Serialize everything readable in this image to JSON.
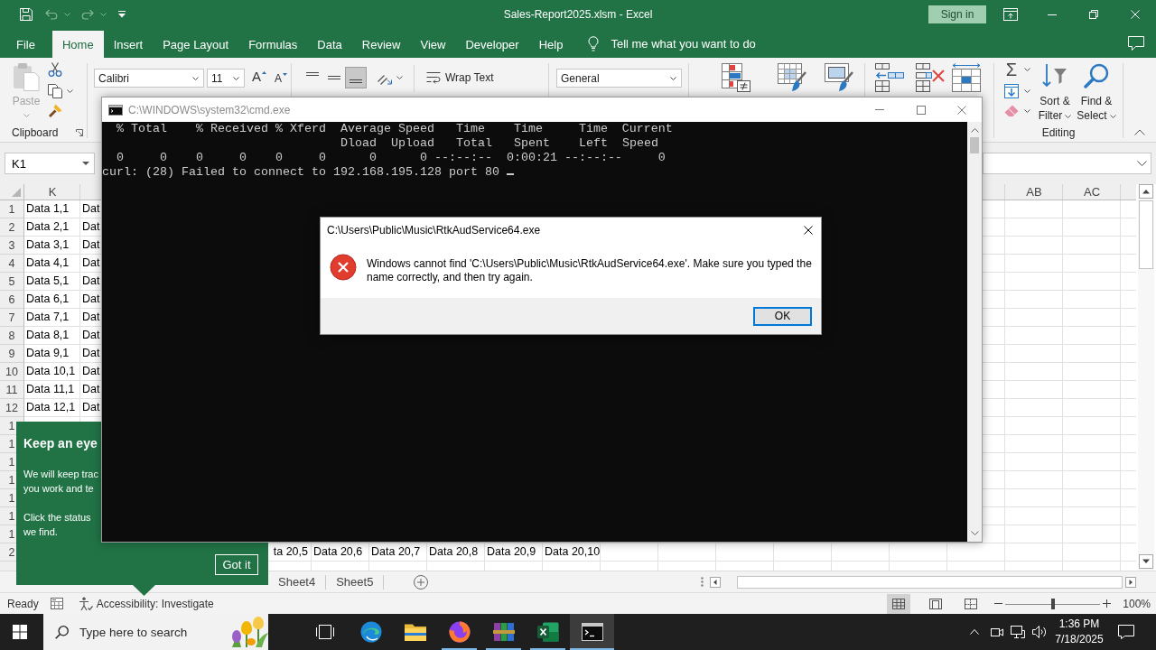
{
  "excel": {
    "quick_access": [
      {
        "kind": "save",
        "disabled": false
      },
      {
        "kind": "undo",
        "disabled": true
      },
      {
        "kind": "redo",
        "disabled": true
      },
      {
        "kind": "customize",
        "disabled": false
      }
    ],
    "title": "Sales-Report2025.xlsm - Excel",
    "sign_in": "Sign in",
    "tabs": [
      {
        "label": "File",
        "selected": false
      },
      {
        "label": "Home",
        "selected": true
      },
      {
        "label": "Insert",
        "selected": false
      },
      {
        "label": "Page Layout",
        "selected": false
      },
      {
        "label": "Formulas",
        "selected": false
      },
      {
        "label": "Data",
        "selected": false
      },
      {
        "label": "Review",
        "selected": false
      },
      {
        "label": "View",
        "selected": false
      },
      {
        "label": "Developer",
        "selected": false
      },
      {
        "label": "Help",
        "selected": false
      }
    ],
    "tell_me": "Tell me what you want to do",
    "ribbon": {
      "clipboard": {
        "paste": {
          "label": "Paste",
          "disabled": true
        },
        "label": "Clipboard"
      },
      "font": {
        "name": "Calibri",
        "size": "11",
        "grow": "A",
        "shrink": "A"
      },
      "alignment": {
        "vertical": [
          {
            "kind": "top",
            "selected": false
          },
          {
            "kind": "middle",
            "selected": false
          },
          {
            "kind": "bottom",
            "selected": true
          }
        ],
        "wrap_text": "Wrap Text"
      },
      "number": {
        "format": "General"
      },
      "editing": {
        "autosum": "Σ",
        "sort_filter": "Sort & Filter",
        "find_select": "Find & Select",
        "label": "Editing"
      }
    },
    "name_box": "K1",
    "sheet": {
      "left_column_headers": [
        "K"
      ],
      "right_column_headers": [
        "AB",
        "AC"
      ],
      "rows": [
        {
          "kind": "left",
          "header": "1",
          "cells": [
            "Data 1,1",
            "Dat"
          ]
        },
        {
          "kind": "left",
          "header": "2",
          "cells": [
            "Data 2,1",
            "Dat"
          ]
        },
        {
          "kind": "left",
          "header": "3",
          "cells": [
            "Data 3,1",
            "Dat"
          ]
        },
        {
          "kind": "left",
          "header": "4",
          "cells": [
            "Data 4,1",
            "Dat"
          ]
        },
        {
          "kind": "left",
          "header": "5",
          "cells": [
            "Data 5,1",
            "Dat"
          ]
        },
        {
          "kind": "left",
          "header": "6",
          "cells": [
            "Data 6,1",
            "Dat"
          ]
        },
        {
          "kind": "left",
          "header": "7",
          "cells": [
            "Data 7,1",
            "Dat"
          ]
        },
        {
          "kind": "left",
          "header": "8",
          "cells": [
            "Data 8,1",
            "Dat"
          ]
        },
        {
          "kind": "left",
          "header": "9",
          "cells": [
            "Data 9,1",
            "Dat"
          ]
        },
        {
          "kind": "left",
          "header": "10",
          "cells": [
            "Data 10,1",
            "Dat"
          ]
        },
        {
          "kind": "left",
          "header": "11",
          "cells": [
            "Data 11,1",
            "Dat"
          ]
        },
        {
          "kind": "left",
          "header": "12",
          "cells": [
            "Data 12,1",
            "Dat"
          ]
        },
        {
          "kind": "left",
          "header": "1"
        },
        {
          "kind": "left",
          "header": "1"
        },
        {
          "kind": "left",
          "header": "1"
        },
        {
          "kind": "left",
          "header": "1"
        },
        {
          "kind": "left",
          "header": "1"
        },
        {
          "kind": "left",
          "header": "1"
        },
        {
          "kind": "left",
          "header": "1"
        },
        {
          "kind": "tail",
          "header": "2",
          "cells": [
            "ta 20,5",
            "Data 20,6",
            "Data 20,7",
            "Data 20,8",
            "Data 20,9",
            "Data 20,10"
          ]
        }
      ]
    },
    "sheet_tabs": [
      {
        "label": "Sheet4",
        "selected": false
      },
      {
        "label": "Sheet5",
        "selected": false
      }
    ],
    "status_bar": {
      "mode": "Ready",
      "accessibility": "Accessibility: Investigate",
      "views": [
        {
          "kind": "normal",
          "selected": true
        },
        {
          "kind": "page_layout",
          "selected": false
        },
        {
          "kind": "page_break",
          "selected": false
        }
      ],
      "zoom": {
        "level": 0.5
      },
      "zoom_reading": "100%"
    }
  },
  "callout": {
    "title": "Keep an eye",
    "paragraphs": [
      [
        "We will keep trac",
        "you work and te"
      ],
      [
        "Click the status",
        "we find."
      ]
    ],
    "button": "Got it"
  },
  "console_window": {
    "title": "C:\\WINDOWS\\system32\\cmd.exe",
    "lines": [
      "  % Total    % Received % Xferd  Average Speed   Time    Time     Time  Current",
      "                                 Dload  Upload   Total   Spent    Left  Speed",
      "  0     0    0     0    0     0      0      0 --:--:--  0:00:21 --:--:--     0",
      "curl: (28) Failed to connect to 192.168.195.128 port 80"
    ],
    "cursor": true
  },
  "dialog": {
    "kind": "error",
    "title": "C:\\Users\\Public\\Music\\RtkAudService64.exe",
    "message": "Windows cannot find 'C:\\Users\\Public\\Music\\RtkAudService64.exe'. Make sure you typed the name correctly, and then try again.",
    "buttons": [
      {
        "label": "OK",
        "default": true
      }
    ]
  },
  "taskbar": {
    "search_placeholder": "Type here to search",
    "apps": [
      {
        "kind": "edge",
        "running": false,
        "active": false
      },
      {
        "kind": "explorer",
        "running": false,
        "active": false
      },
      {
        "kind": "firefox",
        "running": true,
        "active": false
      },
      {
        "kind": "winrar",
        "running": true,
        "active": false
      },
      {
        "kind": "excel",
        "running": true,
        "active": false
      },
      {
        "kind": "cmd",
        "running": true,
        "active": true
      }
    ],
    "clock": {
      "time": "1:36 PM",
      "date": "7/18/2025"
    }
  }
}
